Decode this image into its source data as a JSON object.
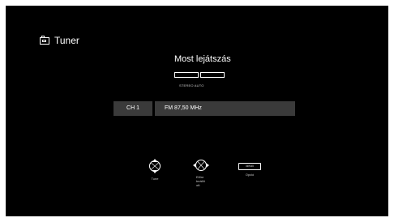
{
  "header": {
    "icon": "tuner-icon",
    "title": "Tuner"
  },
  "now_playing": {
    "title": "Most lejátszás",
    "mode": "STEREO AUTO"
  },
  "channel": {
    "label": "CH 1",
    "frequency": "FM 87,50 MHz"
  },
  "controls": [
    {
      "icon": "tune-updown-icon",
      "label": "Tune"
    },
    {
      "icon": "preset-leftright-icon",
      "label": "Előre beállított"
    },
    {
      "icon": "option-key-icon",
      "key_text": "OPCIÓ",
      "label": "Opció"
    }
  ],
  "colors": {
    "background": "#000000",
    "frame": "#ffffff",
    "bar": "#3a3a3a",
    "text": "#ffffff"
  }
}
